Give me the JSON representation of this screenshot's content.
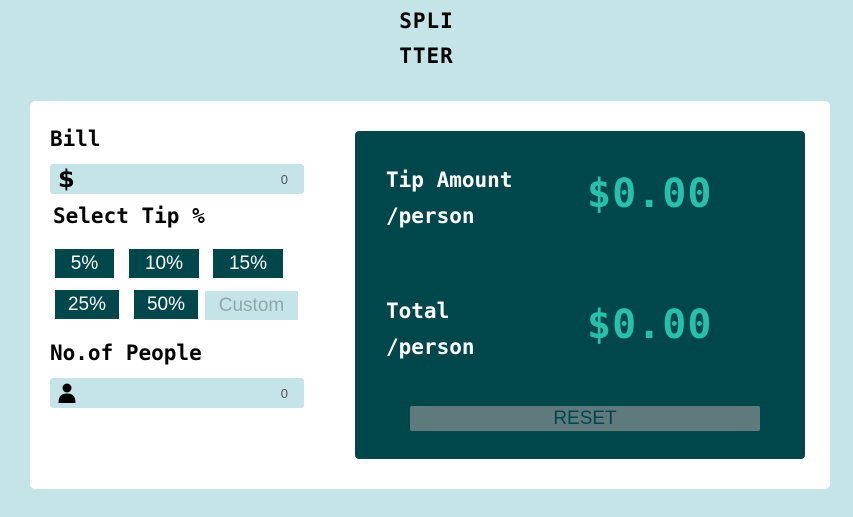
{
  "logo": {
    "line1": "SPLI",
    "line2": "TTER"
  },
  "bill": {
    "label": "Bill",
    "icon": "dollar-icon",
    "icon_glyph": "$",
    "value": "0"
  },
  "tip": {
    "label": "Select Tip %",
    "options": [
      "5%",
      "10%",
      "15%",
      "25%",
      "50%"
    ],
    "custom_placeholder": "Custom"
  },
  "people": {
    "label": "No.of People",
    "icon": "person-icon",
    "value": "0"
  },
  "result": {
    "tip_label_line1": "Tip Amount",
    "tip_label_line2": "/person",
    "tip_value": "$0.00",
    "total_label_line1": "Total",
    "total_label_line2": "/person",
    "total_value": "$0.00",
    "reset_label": "RESET"
  },
  "colors": {
    "background": "#c5e4e7",
    "dark_cyan": "#00474b",
    "accent": "#26c0ab",
    "reset_disabled": "#5e7a7d"
  }
}
